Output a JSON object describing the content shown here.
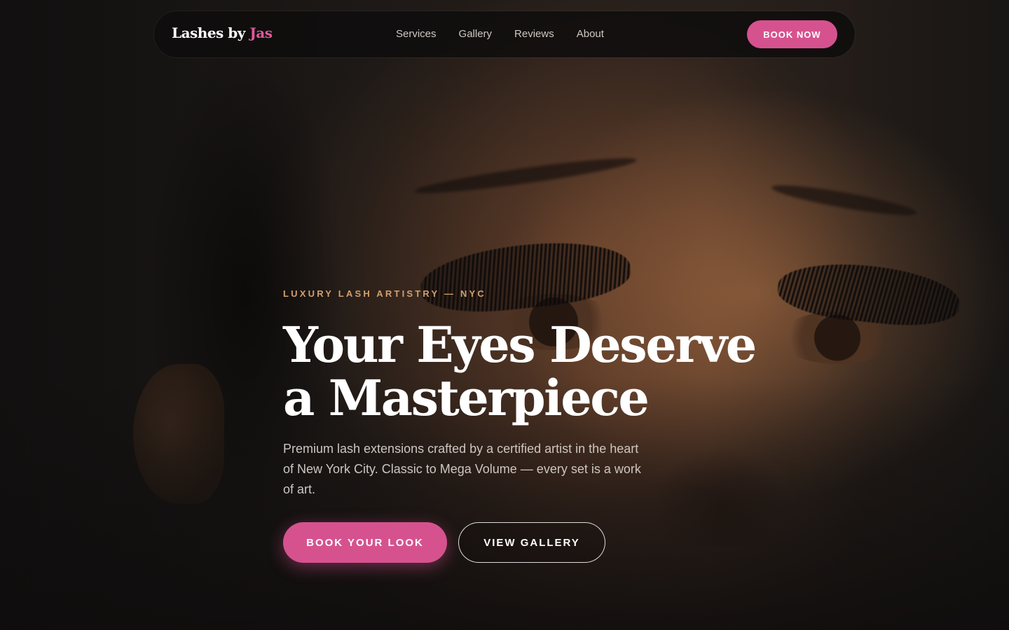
{
  "nav": {
    "logo_main": "Lashes by",
    "logo_accent": "Jas",
    "links": [
      "Services",
      "Gallery",
      "Reviews",
      "About"
    ],
    "cta": "BOOK NOW"
  },
  "hero": {
    "eyebrow": "LUXURY LASH ARTISTRY — NYC",
    "headline_line1": "Your Eyes Deserve",
    "headline_line2": "a Masterpiece",
    "subcopy": "Premium lash extensions crafted by a certified artist in the heart of New York City. Classic to Mega Volume — every set is a work of art.",
    "primary_button": "BOOK YOUR LOOK",
    "secondary_button": "VIEW GALLERY"
  },
  "colors": {
    "accent": "#d6528f",
    "eyebrow": "#d0a070"
  }
}
